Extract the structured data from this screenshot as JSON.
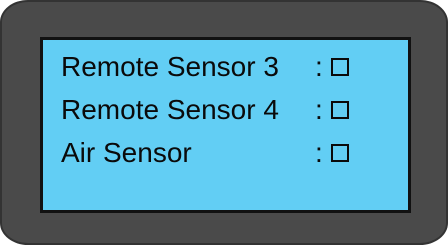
{
  "sensors": [
    {
      "label": "Remote Sensor 3",
      "separator": ":",
      "checked": false
    },
    {
      "label": "Remote Sensor 4",
      "separator": ":",
      "checked": false
    },
    {
      "label": "Air Sensor",
      "separator": ":",
      "checked": false
    }
  ],
  "colors": {
    "bezel": "#4a4a4a",
    "screen": "#62cef4",
    "text": "#0a0a0a"
  }
}
